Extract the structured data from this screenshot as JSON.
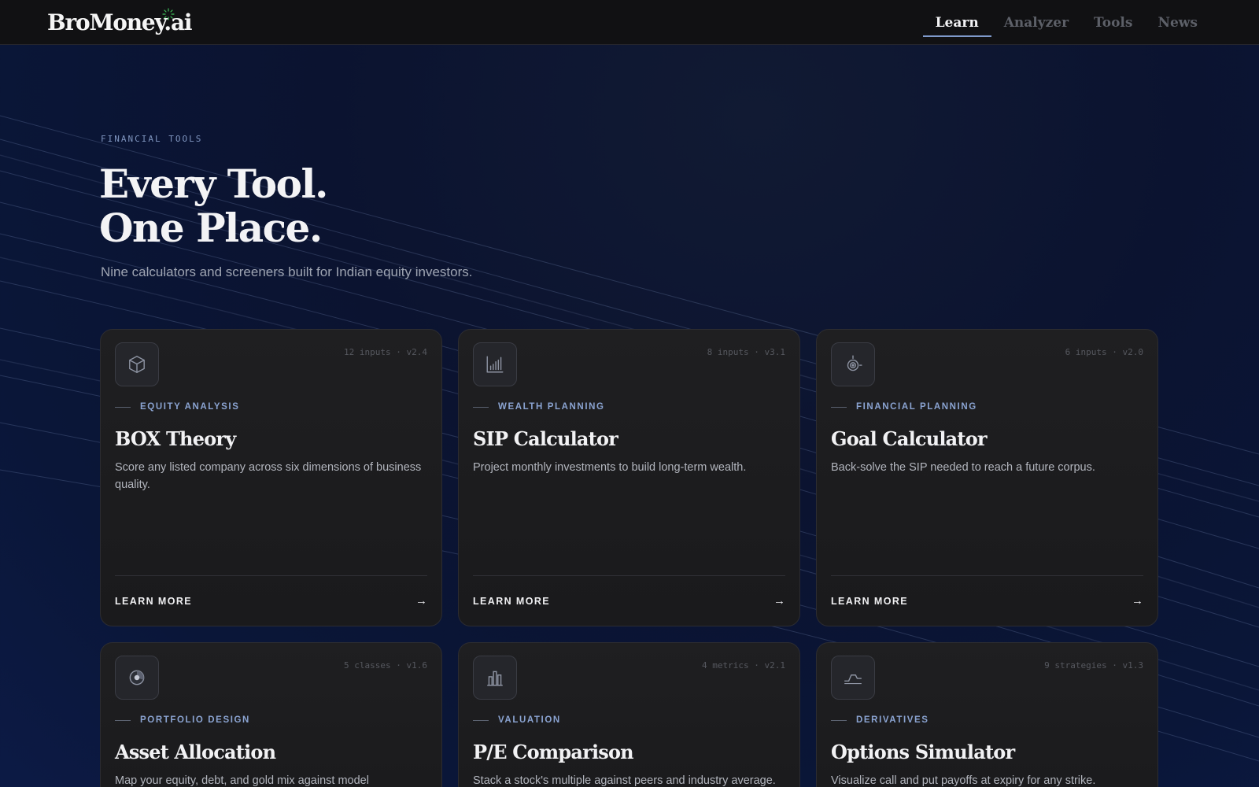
{
  "brand": {
    "name": "BroMoney.ai",
    "accent": "#7f9acb",
    "spark_color": "#3fbf5a"
  },
  "nav": {
    "items": [
      {
        "label": "Learn",
        "active": true
      },
      {
        "label": "Analyzer",
        "active": false
      },
      {
        "label": "Tools",
        "active": false
      },
      {
        "label": "News",
        "active": false
      }
    ]
  },
  "hero": {
    "eyebrow": "FINANCIAL TOOLS",
    "title_line1": "Every Tool.",
    "title_line2": "One Place.",
    "subtitle": "Nine calculators and screeners built for Indian equity investors."
  },
  "cards": [
    {
      "icon": "cube-icon",
      "meta": "12 inputs · v2.4",
      "category": "EQUITY ANALYSIS",
      "title": "BOX Theory",
      "description": "Score any listed company across six dimensions of business quality.",
      "cta": "LEARN MORE",
      "cta_icon": "arrow-right-icon"
    },
    {
      "icon": "bar-chart-icon",
      "meta": "8 inputs · v3.1",
      "category": "WEALTH PLANNING",
      "title": "SIP Calculator",
      "description": "Project monthly investments to build long-term wealth.",
      "cta": "LEARN MORE",
      "cta_icon": "arrow-right-icon"
    },
    {
      "icon": "target-icon",
      "meta": "6 inputs · v2.0",
      "category": "FINANCIAL PLANNING",
      "title": "Goal Calculator",
      "description": "Back-solve the SIP needed to reach a future corpus.",
      "cta": "LEARN MORE",
      "cta_icon": "arrow-right-icon"
    },
    {
      "icon": "pie-chart-icon",
      "meta": "5 classes · v1.6",
      "category": "PORTFOLIO DESIGN",
      "title": "Asset Allocation",
      "description": "Map your equity, debt, and gold mix against model"
    },
    {
      "icon": "columns-chart-icon",
      "meta": "4 metrics · v2.1",
      "category": "VALUATION",
      "title": "P/E Comparison",
      "description": "Stack a stock's multiple against peers and industry average."
    },
    {
      "icon": "payoff-chart-icon",
      "meta": "9 strategies · v1.3",
      "category": "DERIVATIVES",
      "title": "Options Simulator",
      "description": "Visualize call and put payoffs at expiry for any strike."
    }
  ]
}
